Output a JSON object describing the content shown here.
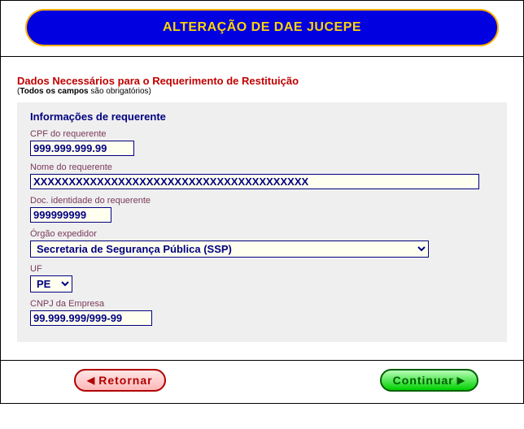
{
  "header": {
    "title": "ALTERAÇÃO DE DAE JUCEPE"
  },
  "section": {
    "title": "Dados Necessários para o Requerimento de Restituição",
    "note_bold": "Todos os campos",
    "note_rest": " são obrigatórios)"
  },
  "group": {
    "title": "Informações de requerente",
    "cpf": {
      "label": "CPF do requerente",
      "value": "999.999.999.99"
    },
    "nome": {
      "label": "Nome do requerente",
      "value": "XXXXXXXXXXXXXXXXXXXXXXXXXXXXXXXXXXXXXXX"
    },
    "doc": {
      "label": "Doc. identidade do requerente",
      "value": "999999999"
    },
    "orgao": {
      "label": "Órgão expedidor",
      "value": "Secretaria de Segurança Pública (SSP)"
    },
    "uf": {
      "label": "UF",
      "value": "PE"
    },
    "cnpj": {
      "label": "CNPJ da Empresa",
      "value": "99.999.999/999-99"
    }
  },
  "footer": {
    "back": "Retornar",
    "cont": "Continuar"
  }
}
